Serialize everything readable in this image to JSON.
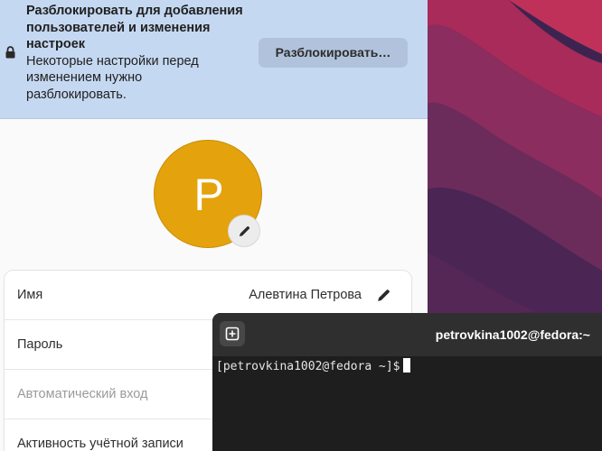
{
  "settings": {
    "banner": {
      "title": "Разблокировать для добавления пользователей и изменения настроек",
      "subtitle": "Некоторые настройки перед изменением нужно разблокировать.",
      "unlock_label": "Разблокировать…"
    },
    "avatar": {
      "initial": "P",
      "color": "#e4a20c"
    },
    "rows": [
      {
        "label": "Имя",
        "value": "Алевтина Петрова"
      },
      {
        "label": "Пароль"
      },
      {
        "label": "Автоматический вход"
      },
      {
        "label": "Активность учётной записи"
      }
    ]
  },
  "terminal": {
    "title": "petrovkina1002@fedora:~",
    "prompt": "[petrovkina1002@fedora ~]$"
  },
  "colors": {
    "banner_bg": "#c5d8f1",
    "avatar_bg": "#e4a20c",
    "terminal_bg": "#1e1e1e"
  }
}
